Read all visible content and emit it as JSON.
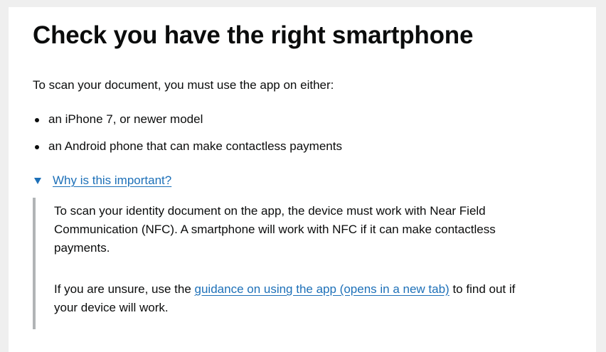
{
  "page": {
    "title": "Check you have the right smartphone",
    "intro": "To scan your document, you must use the app on either:",
    "requirements": [
      "an iPhone 7, or newer model",
      "an Android phone that can make contactless payments"
    ]
  },
  "details": {
    "summary": "Why is this important?",
    "expanded": true,
    "paragraph1": "To scan your identity document on the app, the device must work with Near Field Communication (NFC). A smartphone will work with NFC if it can make contactless payments.",
    "paragraph2_before": "If you are unsure, use the ",
    "paragraph2_link": "guidance on using the app (opens in a new tab)",
    "paragraph2_after": " to find out if your device will work."
  },
  "colors": {
    "link": "#1d70b8",
    "text": "#0b0c0c",
    "details_border": "#b1b4b6",
    "background": "#efefef"
  },
  "icons": {
    "details_toggle": "triangle-down-icon"
  }
}
